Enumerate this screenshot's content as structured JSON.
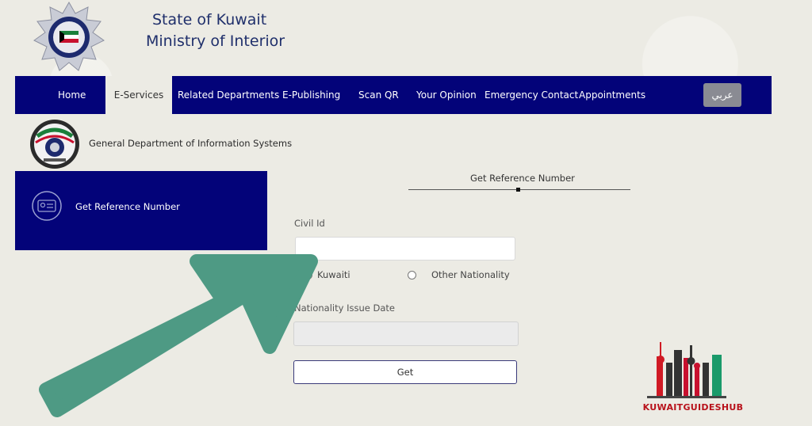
{
  "header": {
    "title_line1": "State of Kuwait",
    "title_line2": "Ministry of Interior"
  },
  "nav": {
    "items": [
      {
        "label": "Home",
        "active": false
      },
      {
        "label": "E-Services",
        "active": true
      },
      {
        "label": "Related Departments",
        "active": false
      },
      {
        "label": "E-Publishing",
        "active": false
      },
      {
        "label": "Scan QR",
        "active": false
      },
      {
        "label": "Your Opinion",
        "active": false
      },
      {
        "label": "Emergency Contact",
        "active": false
      },
      {
        "label": "Appointments",
        "active": false
      }
    ],
    "language_button": "عربي"
  },
  "department": {
    "name": "General Department of Information Systems"
  },
  "sidebar": {
    "item_label": "Get Reference Number",
    "icon": "id-card-icon"
  },
  "form": {
    "step_title": "Get Reference Number",
    "civil_id_label": "Civil Id",
    "civil_id_value": "",
    "nationality_options": [
      "Kuwaiti",
      "Other Nationality"
    ],
    "nationality_date_label": "Nationality Issue Date",
    "nationality_date_value": "",
    "submit_label": "Get"
  },
  "watermark": {
    "text": "KUWAITGUIDESHUB"
  },
  "colors": {
    "navy": "#030379",
    "background": "#ecebe4",
    "arrow": "#4e9a84",
    "watermark_red": "#b8121b"
  }
}
